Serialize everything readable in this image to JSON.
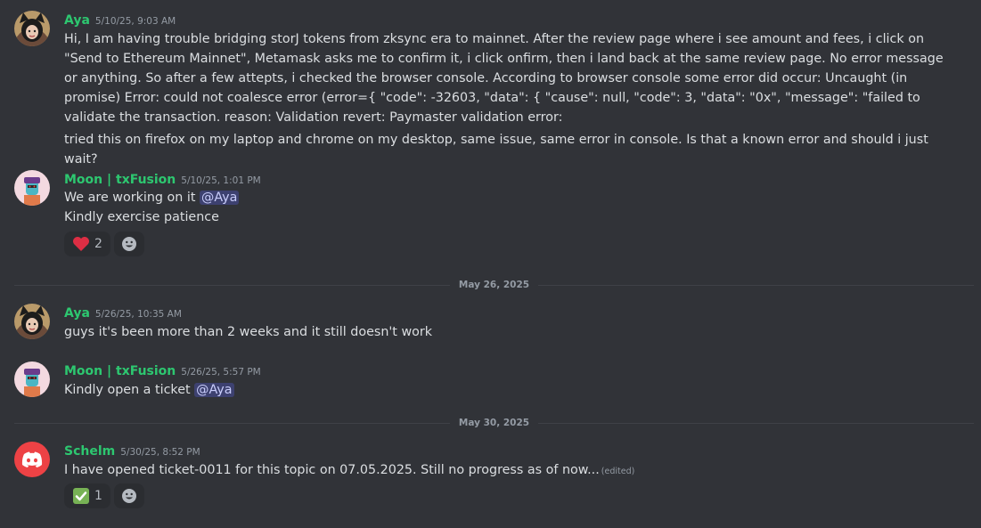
{
  "messages": [
    {
      "username": "Aya",
      "timestamp": "5/10/25, 9:03 AM",
      "paragraphs": [
        "Hi, I am having trouble bridging storJ tokens from zksync era to mainnet. After the review page where i see amount and fees, i click on \"Send to Ethereum Mainnet\", Metamask asks me to confirm it, i click onfirm, then i land back at the same review page. No error message or anything. So after a few attepts, i checked the browser console. According to browser console some error did occur: Uncaught (in promise) Error: could not coalesce error (error={ \"code\": -32603, \"data\": { \"cause\": null, \"code\": 3, \"data\": \"0x\", \"message\": \"failed to validate the transaction. reason: Validation revert: Paymaster validation error:",
        "tried this on firefox on my laptop and chrome on my desktop, same issue, same error in console. Is that a known error and should i just wait?"
      ]
    },
    {
      "username": "Moon | txFusion",
      "timestamp": "5/10/25, 1:01 PM",
      "line1": "We are working on it ",
      "mention": "@Aya",
      "line2": "Kindly exercise patience",
      "reaction_count": "2"
    },
    {
      "username": "Aya",
      "timestamp": "5/26/25, 10:35 AM",
      "text": "guys it's been more than 2 weeks and it still doesn't work"
    },
    {
      "username": "Moon | txFusion",
      "timestamp": "5/26/25, 5:57 PM",
      "text": "Kindly open a ticket ",
      "mention": "@Aya"
    },
    {
      "username": "Schelm",
      "timestamp": "5/30/25, 8:52 PM",
      "text": "I have opened ticket-0011  for this topic on 07.05.2025. Still no progress as of now...",
      "edited": "(edited)",
      "reaction_count": "1"
    }
  ],
  "dividers": [
    "May 26, 2025",
    "May 30, 2025"
  ],
  "icons": {
    "heart": "heart-emoji",
    "check": "white-check-mark-emoji",
    "add_reaction": "add-reaction-icon"
  },
  "colors": {
    "background": "#313338",
    "username": "#2dc770",
    "mention_bg": "#3c4270",
    "schelm_avatar": "#ed4245"
  }
}
